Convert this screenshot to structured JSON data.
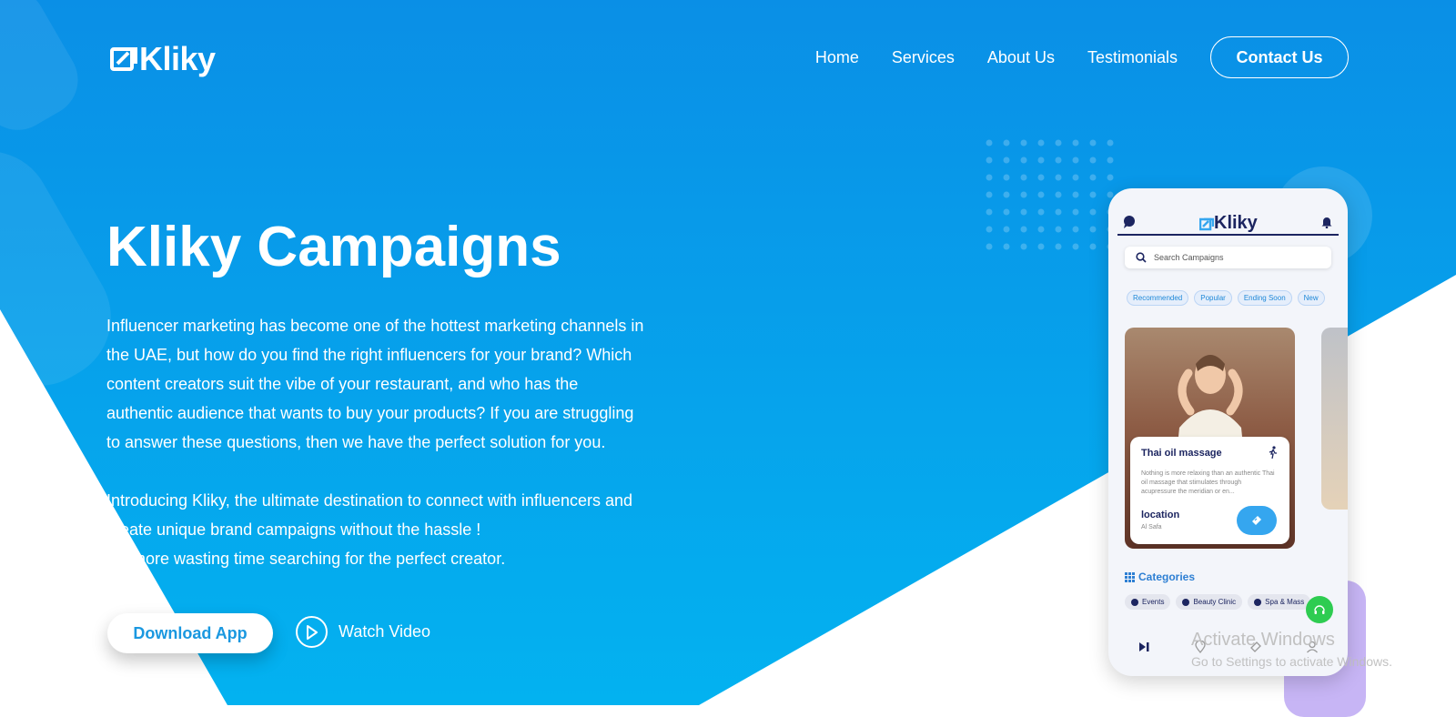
{
  "brand": {
    "name": "Kliky"
  },
  "nav": {
    "links": [
      "Home",
      "Services",
      "About Us",
      "Testimonials"
    ],
    "contact_label": "Contact Us"
  },
  "hero": {
    "title": "Kliky Campaigns",
    "paragraph1_lines": [
      "Influencer marketing has become one of the hottest marketing channels in",
      "the UAE, but how do you find the right influencers for your brand? Which",
      "content creators suit the vibe of your restaurant, and who has the",
      "authentic audience that wants to buy your products? If you are struggling",
      "to answer these questions, then we have the perfect solution for you."
    ],
    "paragraph2_lines": [
      "Introducing Kliky, the ultimate destination to connect with influencers and",
      "create unique brand campaigns without the hassle !",
      "No more wasting time searching for the perfect creator."
    ],
    "download_label": "Download App",
    "watch_label": "Watch Video"
  },
  "phone": {
    "app_name": "Kliky",
    "search_placeholder": "Search Campaigns",
    "chips": [
      "Recommended",
      "Popular",
      "Ending Soon",
      "New"
    ],
    "card": {
      "title": "Thai oil massage",
      "description": "Nothing is more relaxing than an authentic Thai oil massage that stimulates through acupressure the meridian or en...",
      "location_label": "location",
      "location_value": "Al Safa"
    },
    "categories_title": "Categories",
    "categories": [
      "Events",
      "Beauty Clinic",
      "Spa & Mass"
    ]
  },
  "os_overlay": {
    "title": "Activate Windows",
    "subtitle": "Go to Settings to activate Windows."
  },
  "colors": {
    "hero_gradient_top": "#0a8fe6",
    "hero_gradient_bottom": "#03b2f0",
    "accent": "#1a98e0",
    "navy": "#1c2560",
    "support_green": "#2ecc51"
  }
}
